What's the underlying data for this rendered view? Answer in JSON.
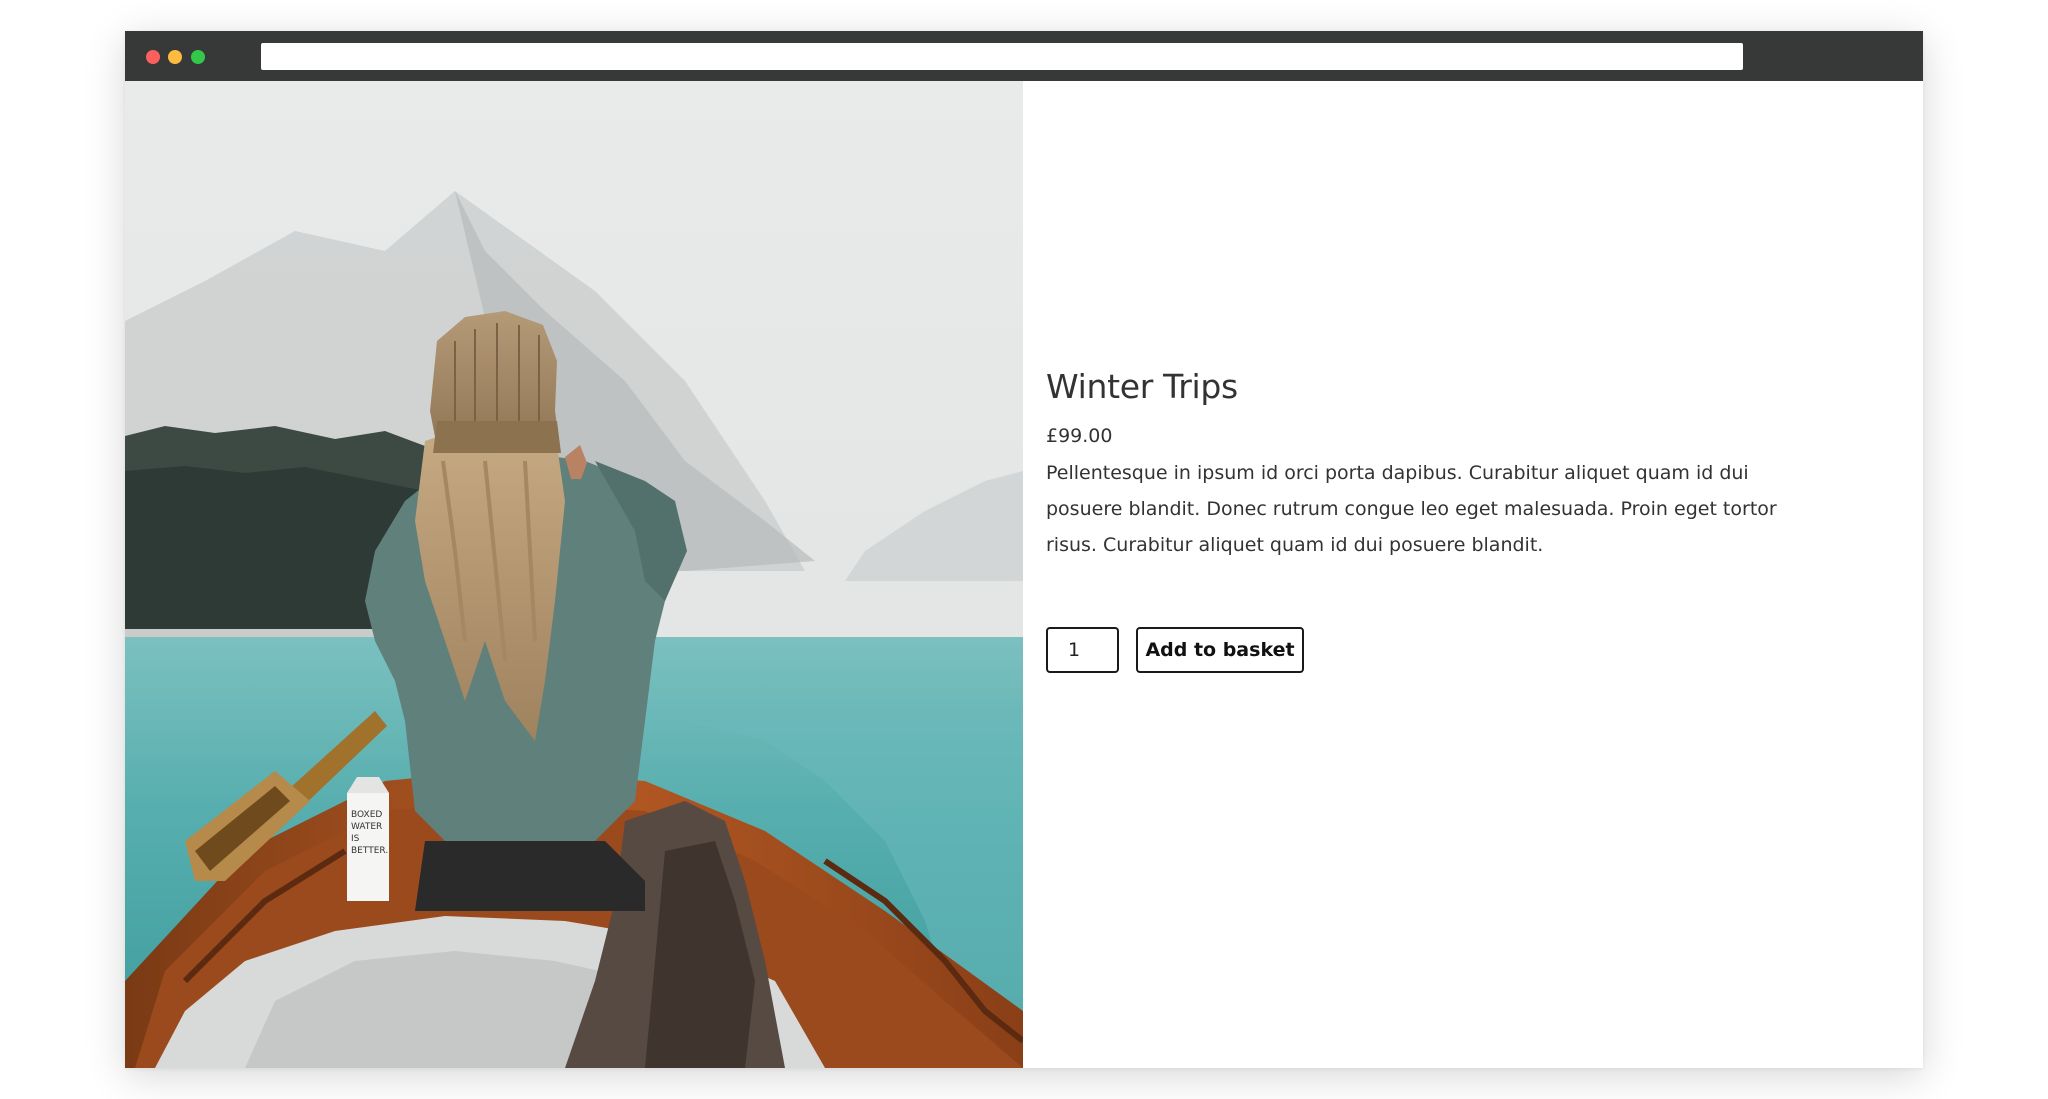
{
  "product": {
    "title": "Winter Trips",
    "price": "£99.00",
    "description": "Pellentesque in ipsum id orci porta dapibus. Curabitur aliquet quam id dui posuere blandit. Donec rutrum congue leo eget malesuada. Proin eget tortor risus. Curabitur aliquet quam id dui posuere blandit.",
    "quantity": "1",
    "add_to_basket_label": "Add to basket"
  },
  "image": {
    "carton_text": "BOXED WATER IS BETTER."
  },
  "window": {
    "controls": [
      "close",
      "minimize",
      "maximize"
    ]
  },
  "colors": {
    "titlebar": "#373838",
    "close": "#fc605c",
    "minimize": "#fdbc40",
    "maximize": "#34c84a",
    "text": "#333333",
    "button_border": "#1a1a1a"
  }
}
